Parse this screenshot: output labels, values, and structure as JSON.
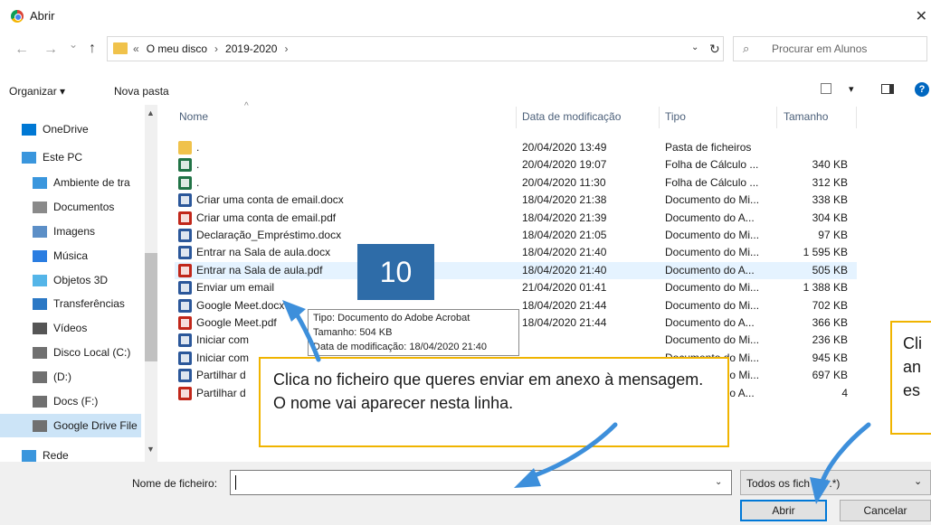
{
  "window": {
    "title": "Abrir",
    "close_glyph": "✕"
  },
  "address": {
    "back_glyph": "←",
    "forward_glyph": "→",
    "dropdown_glyph": "⌄",
    "up_glyph": "↑",
    "crumbs": [
      "«",
      "O meu disco",
      "›",
      "2019-2020",
      "›"
    ],
    "refresh_glyph": "↻",
    "search_placeholder": "Procurar em Alunos"
  },
  "toolbar": {
    "organize": "Organizar ▾",
    "new_folder": "Nova pasta",
    "view_dd": "▾",
    "help": "?"
  },
  "sidebar": {
    "items": [
      {
        "label": "OneDrive",
        "icon": "cloud-icon"
      },
      {
        "label": "Este PC",
        "icon": "pc-icon"
      },
      {
        "label": "Ambiente de tra",
        "icon": "desktop-icon"
      },
      {
        "label": "Documentos",
        "icon": "documents-icon"
      },
      {
        "label": "Imagens",
        "icon": "pictures-icon"
      },
      {
        "label": "Música",
        "icon": "music-icon"
      },
      {
        "label": "Objetos 3D",
        "icon": "objects3d-icon"
      },
      {
        "label": "Transferências",
        "icon": "downloads-icon"
      },
      {
        "label": "Vídeos",
        "icon": "videos-icon"
      },
      {
        "label": "Disco Local (C:)",
        "icon": "drive-icon"
      },
      {
        "label": "(D:)",
        "icon": "drive-icon"
      },
      {
        "label": "Docs    (F:)",
        "icon": "drive-icon"
      },
      {
        "label": "Google Drive File",
        "icon": "drive-icon"
      },
      {
        "label": "Rede",
        "icon": "network-icon"
      }
    ],
    "selected_index": 12
  },
  "columns": {
    "name": "Nome",
    "date": "Data de modificação",
    "type": "Tipo",
    "size": "Tamanho",
    "sort_glyph": "^"
  },
  "files": [
    {
      "name": ".",
      "date": "20/04/2020 13:49",
      "type": "Pasta de ficheiros",
      "size": "",
      "kind": "folder"
    },
    {
      "name": ".",
      "date": "20/04/2020 19:07",
      "type": "Folha de Cálculo ...",
      "size": "340 KB",
      "kind": "excel"
    },
    {
      "name": ".",
      "date": "20/04/2020 11:30",
      "type": "Folha de Cálculo ...",
      "size": "312 KB",
      "kind": "excel"
    },
    {
      "name": "Criar uma conta de email.docx",
      "date": "18/04/2020 21:38",
      "type": "Documento do Mi...",
      "size": "338 KB",
      "kind": "word"
    },
    {
      "name": "Criar uma conta de email.pdf",
      "date": "18/04/2020 21:39",
      "type": "Documento do A...",
      "size": "304 KB",
      "kind": "pdf"
    },
    {
      "name": "Declaração_Empréstimo.docx",
      "date": "18/04/2020 21:05",
      "type": "Documento do Mi...",
      "size": "97 KB",
      "kind": "word"
    },
    {
      "name": "Entrar na Sala de aula.docx",
      "date": "18/04/2020 21:40",
      "type": "Documento do Mi...",
      "size": "1 595 KB",
      "kind": "word"
    },
    {
      "name": "Entrar na Sala de aula.pdf",
      "date": "18/04/2020 21:40",
      "type": "Documento do A...",
      "size": "505 KB",
      "kind": "pdf"
    },
    {
      "name": "Enviar um email",
      "date": "21/04/2020 01:41",
      "type": "Documento do Mi...",
      "size": "1 388 KB",
      "kind": "word"
    },
    {
      "name": "Google Meet.docx",
      "date": "18/04/2020 21:44",
      "type": "Documento do Mi...",
      "size": "702 KB",
      "kind": "word"
    },
    {
      "name": "Google Meet.pdf",
      "date": "18/04/2020 21:44",
      "type": "Documento do A...",
      "size": "366 KB",
      "kind": "pdf"
    },
    {
      "name": "Iniciar com",
      "date": "",
      "type": "Documento do Mi...",
      "size": "236 KB",
      "kind": "word"
    },
    {
      "name": "Iniciar com",
      "date": "",
      "type": "Documento do Mi...",
      "size": "945 KB",
      "kind": "word"
    },
    {
      "name": "Partilhar d",
      "date": "",
      "type": "Documento do Mi...",
      "size": "697 KB",
      "kind": "word"
    },
    {
      "name": "Partilhar d",
      "date": "",
      "type": "Documento do A...",
      "size": "4",
      "kind": "pdf"
    }
  ],
  "highlighted_row": 7,
  "tooltip": {
    "line1": "Tipo: Documento do Adobe Acrobat",
    "line2": "Tamanho: 504 KB",
    "line3": "Data de modificação: 18/04/2020 21:40"
  },
  "step_badge": "10",
  "callout_main": "Clica no ficheiro que queres enviar em anexo à mensagem. O nome vai aparecer nesta linha.",
  "callout_right": [
    "Cli",
    "an",
    "es"
  ],
  "bottom": {
    "filename_label": "Nome de ficheiro:",
    "filename_value": "",
    "filetype": "Todos os fich   s (*.*)",
    "filetype_dd": "⌄",
    "open": "Abrir",
    "cancel": "Cancelar"
  },
  "colors": {
    "accent": "#0078d7",
    "callout_border": "#f0b400",
    "badge": "#2e6ca8",
    "arrow": "#3d8fdb"
  }
}
